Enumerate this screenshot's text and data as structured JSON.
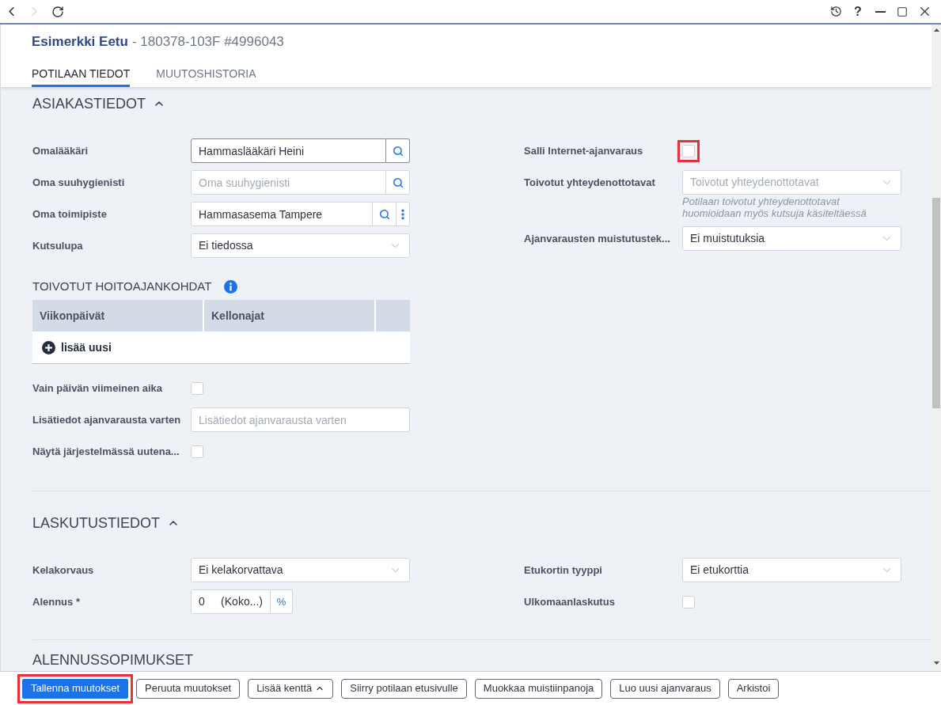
{
  "nav": [
    {
      "kind": "back",
      "disabled": false
    },
    {
      "kind": "forward",
      "disabled": true
    },
    {
      "kind": "reload",
      "disabled": false
    }
  ],
  "window_controls": [
    {
      "kind": "history"
    },
    {
      "kind": "help",
      "glyph": "?"
    },
    {
      "kind": "minimize"
    },
    {
      "kind": "maximize"
    },
    {
      "kind": "close"
    }
  ],
  "header": {
    "patient_name": "Esimerkki Eetu",
    "patient_id": "- 180378-103F #4996043"
  },
  "tabs": [
    {
      "label": "POTILAAN TIEDOT",
      "selected": true
    },
    {
      "label": "MUUTOSHISTORIA",
      "selected": false
    }
  ],
  "customer_section": {
    "title": "ASIAKASTIEDOT",
    "expanded": true,
    "fields_left": [
      {
        "kind": "lookup",
        "label": "Omalääkäri",
        "value": "Hammaslääkäri Heini",
        "focused": true
      },
      {
        "kind": "lookup",
        "label": "Oma suuhygienisti",
        "placeholder": "Oma suuhygienisti",
        "focused": false
      },
      {
        "kind": "lookup_menu",
        "label": "Oma toimipiste",
        "value": "Hammasasema Tampere",
        "focused": false
      },
      {
        "kind": "select",
        "label": "Kutsulupa",
        "value": "Ei tiedossa",
        "focused": false
      }
    ],
    "preferred_times": {
      "title": "TOIVOTUT HOITOAJANKOHDAT",
      "columns": [
        "Viikonpäivät",
        "Kellonajat"
      ],
      "add_label": "lisää uusi"
    },
    "fields_after": [
      {
        "kind": "checkbox",
        "label": "Vain päivän viimeinen aika",
        "checked": false
      },
      {
        "kind": "text",
        "label": "Lisätiedot ajanvarausta varten",
        "placeholder": "Lisätiedot ajanvarausta varten"
      },
      {
        "kind": "checkbox",
        "label": "Näytä järjestelmässä uutena...",
        "checked": false
      }
    ],
    "fields_right": [
      {
        "kind": "checkbox",
        "label": "Salli Internet-ajanvaraus",
        "checked": false,
        "highlighted": true
      },
      {
        "kind": "select",
        "label": "Toivotut yhteydenottotavat",
        "placeholder": "Toivotut yhteydenottotavat",
        "hint": "Potilaan toivotut yhteydenottotavat huomioidaan myös kutsuja käsiteltäessä",
        "highlighted": false
      },
      {
        "kind": "select",
        "label": "Ajanvarausten muistutustek...",
        "value": "Ei muistutuksia",
        "highlighted": false
      }
    ]
  },
  "billing_section": {
    "title": "LASKUTUSTIEDOT",
    "expanded": true,
    "fields_left": [
      {
        "kind": "select",
        "label": "Kelakorvaus",
        "value": "Ei kelakorvattava"
      },
      {
        "kind": "percent",
        "label": "Alennus *",
        "value": "0",
        "note": "(Koko...)",
        "unit": "%"
      }
    ],
    "fields_right": [
      {
        "kind": "select",
        "label": "Etukortin tyyppi",
        "value": "Ei etukorttia"
      },
      {
        "kind": "checkbox",
        "label": "Ulkomaanlaskutus",
        "checked": false
      }
    ]
  },
  "discount_section": {
    "title": "ALENNUSSOPIMUKSET"
  },
  "footer": {
    "buttons": [
      {
        "kind": "primary",
        "label": "Tallenna muutokset",
        "highlighted": true
      },
      {
        "kind": "secondary",
        "label": "Peruuta muutokset",
        "highlighted": false
      },
      {
        "kind": "dropdown",
        "label": "Lisää kenttä",
        "highlighted": false
      },
      {
        "kind": "secondary",
        "label": "Siirry potilaan etusivulle",
        "highlighted": false
      },
      {
        "kind": "secondary",
        "label": "Muokkaa muistiinpanoja",
        "highlighted": false
      },
      {
        "kind": "secondary",
        "label": "Luo uusi ajanvaraus",
        "highlighted": false
      },
      {
        "kind": "secondary",
        "label": "Arkistoi",
        "highlighted": false
      }
    ]
  }
}
